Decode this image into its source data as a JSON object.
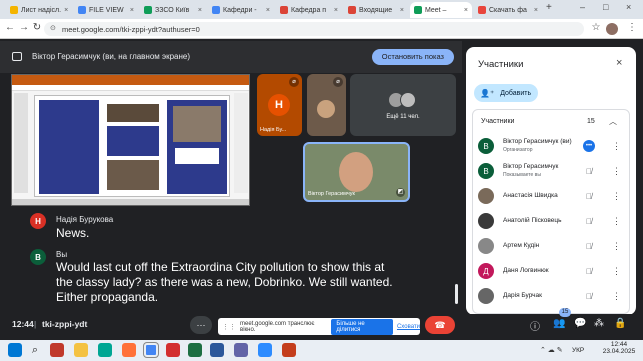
{
  "browser": {
    "tabs": [
      {
        "label": "Лист надісл.",
        "color": "#f4b400"
      },
      {
        "label": "FILE VIEW",
        "color": "#4285f4"
      },
      {
        "label": "ЗЗСО Київ",
        "color": "#0f9d58"
      },
      {
        "label": "Кафедри -",
        "color": "#4285f4"
      },
      {
        "label": "Кафедра п",
        "color": "#db4437"
      },
      {
        "label": "Входящие",
        "color": "#db4437"
      },
      {
        "label": "Meet –",
        "color": "#0f9d58"
      },
      {
        "label": "Скачать фа",
        "color": "#e8453c"
      }
    ],
    "url": "meet.google.com/tki-zppi-ydt?authuser=0"
  },
  "share_banner": {
    "text": "Віктор Герасимчук (ви, на главном экране)",
    "stop_label": "Остановить показ"
  },
  "tiles": {
    "nadia_letter": "Н",
    "nadia_name": "Надія Бу...",
    "others_label": "Ещё 11 чел.",
    "viktor_name": "Віктор Герасимчук"
  },
  "chat": {
    "m1_avatar": "Н",
    "m1_name": "Надія Бурукова",
    "m1_text": "News.",
    "m2_avatar": "В",
    "m2_name": "Вы",
    "m2_text": "Would last cut off the Extraordina City pollution to show this at the classy lady? as there was a new, Dobrinko. We still wanted. Either propaganda."
  },
  "panel": {
    "title": "Участники",
    "add_label": "Добавить",
    "section": "Участники",
    "count": "15",
    "people": [
      {
        "name": "Віктор Герасимчук (ви)",
        "sub": "Организатор",
        "letter": "В",
        "color": "#0b5e3a"
      },
      {
        "name": "Віктор Герасимчук",
        "sub": "Показываете вы",
        "letter": "В",
        "color": "#0b5e3a"
      },
      {
        "name": "Анастасія Швидка",
        "sub": "",
        "letter": "",
        "color": "#7a6a5a"
      },
      {
        "name": "Анатолій Пісковець",
        "sub": "",
        "letter": "",
        "color": "#3a3a3a"
      },
      {
        "name": "Артем Кудін",
        "sub": "",
        "letter": "",
        "color": "#888888"
      },
      {
        "name": "Даня Логвинюк",
        "sub": "",
        "letter": "Д",
        "color": "#c2185b"
      },
      {
        "name": "Дарія Бурчак",
        "sub": "",
        "letter": "",
        "color": "#666666"
      }
    ]
  },
  "bottom": {
    "time": "12:44",
    "meeting_code": "tki-zppi-ydt",
    "badge": "15",
    "toast_text": "meet.google.com транслює вікно.",
    "toast_stop": "Більше не ділитися",
    "toast_hide": "Сховати"
  },
  "taskbar": {
    "lang": "УКР",
    "time": "12:44",
    "date": "23.04.2025"
  }
}
